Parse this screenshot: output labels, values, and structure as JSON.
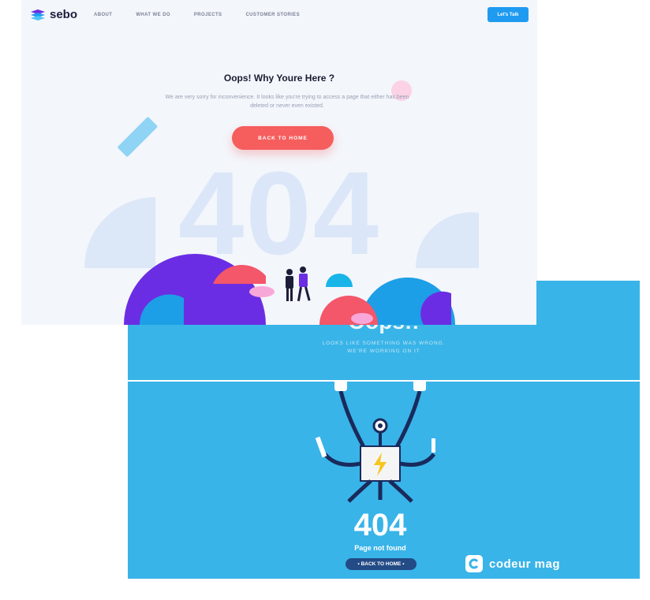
{
  "screens": [
    {
      "brand": "sebo",
      "nav": [
        "ABOUT",
        "WHAT WE DO",
        "PROJECTS",
        "CUSTOMER STORIES"
      ],
      "cta": "Let's Talk",
      "title": "Oops! Why Youre Here ?",
      "description": "We are very sorry for inconvenience. It looks like you're trying to access a page that either has been deleted or never even existed.",
      "button": "BACK TO HOME",
      "big_text": "404",
      "colors": {
        "primary": "#1e9bf0",
        "button": "#f65d5d",
        "purple": "#6b2de3"
      }
    },
    {
      "heading": "Oops!!",
      "subtext": [
        "LOOKS LIKE SOMETHING WAS WRONG.",
        "WE'RE WORKING ON IT"
      ],
      "code": "404",
      "message": "Page not found",
      "button": "• BACK TO HOME •",
      "brand": "codeur mag",
      "colors": {
        "background": "#38b4e8",
        "button": "#234b86"
      }
    }
  ]
}
